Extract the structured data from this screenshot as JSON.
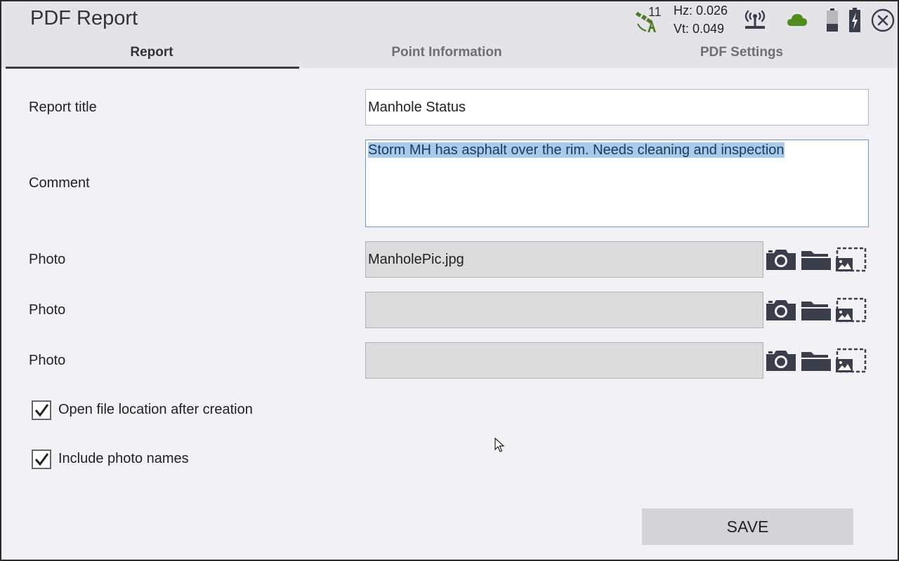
{
  "app": {
    "title": "PDF Report"
  },
  "status": {
    "satellite_count": "11",
    "hz": "Hz: 0.026",
    "vt": "Vt: 0.049",
    "icons": [
      "satellite-icon",
      "radio-icon",
      "cloud-icon",
      "battery-icon",
      "battery-charging-icon",
      "close-icon"
    ],
    "colors": {
      "satellite": "#4e7a2b",
      "cloud": "#4e8c1e",
      "icon_dark": "#3a3d4a"
    }
  },
  "tabs": [
    {
      "label": "Report",
      "active": true
    },
    {
      "label": "Point Information",
      "active": false
    },
    {
      "label": "PDF Settings",
      "active": false
    }
  ],
  "form": {
    "report_title_label": "Report title",
    "report_title_value": "Manhole Status",
    "comment_label": "Comment",
    "comment_value": "Storm MH has asphalt over the rim.  Needs cleaning and inspection",
    "photos": [
      {
        "label": "Photo",
        "value": "ManholePic.jpg"
      },
      {
        "label": "Photo",
        "value": ""
      },
      {
        "label": "Photo",
        "value": ""
      }
    ],
    "photo_button_icons": [
      "camera-icon",
      "folder-icon",
      "image-select-icon"
    ],
    "open_file_location": {
      "label": "Open file location after creation",
      "checked": true
    },
    "include_photo_names": {
      "label": "Include photo names",
      "checked": true
    }
  },
  "actions": {
    "save_label": "SAVE"
  }
}
